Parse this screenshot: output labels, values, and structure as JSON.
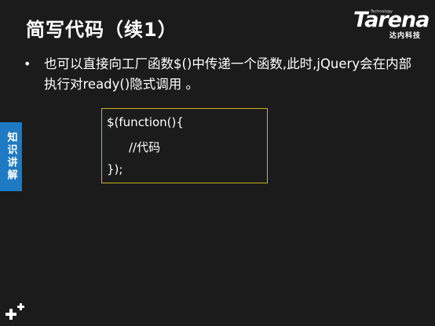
{
  "slide": {
    "title": "简写代码（续1）",
    "bullet": "也可以直接向工厂函数$()中传递一个函数,此时,jQuery会在内部执行对ready()隐式调用 。",
    "side_tab": "知识讲解"
  },
  "logo": {
    "word": "Tarena",
    "tech": "Technology",
    "sub": "达内科技"
  },
  "code": {
    "line1": "$(function(){",
    "line2": "//代码",
    "line3": "});"
  },
  "colors": {
    "background": "#1b1b1b",
    "side_tab": "#1e7ac2",
    "code_border": "#c8b420"
  },
  "icons": {
    "corner": "plus-cluster-icon"
  }
}
